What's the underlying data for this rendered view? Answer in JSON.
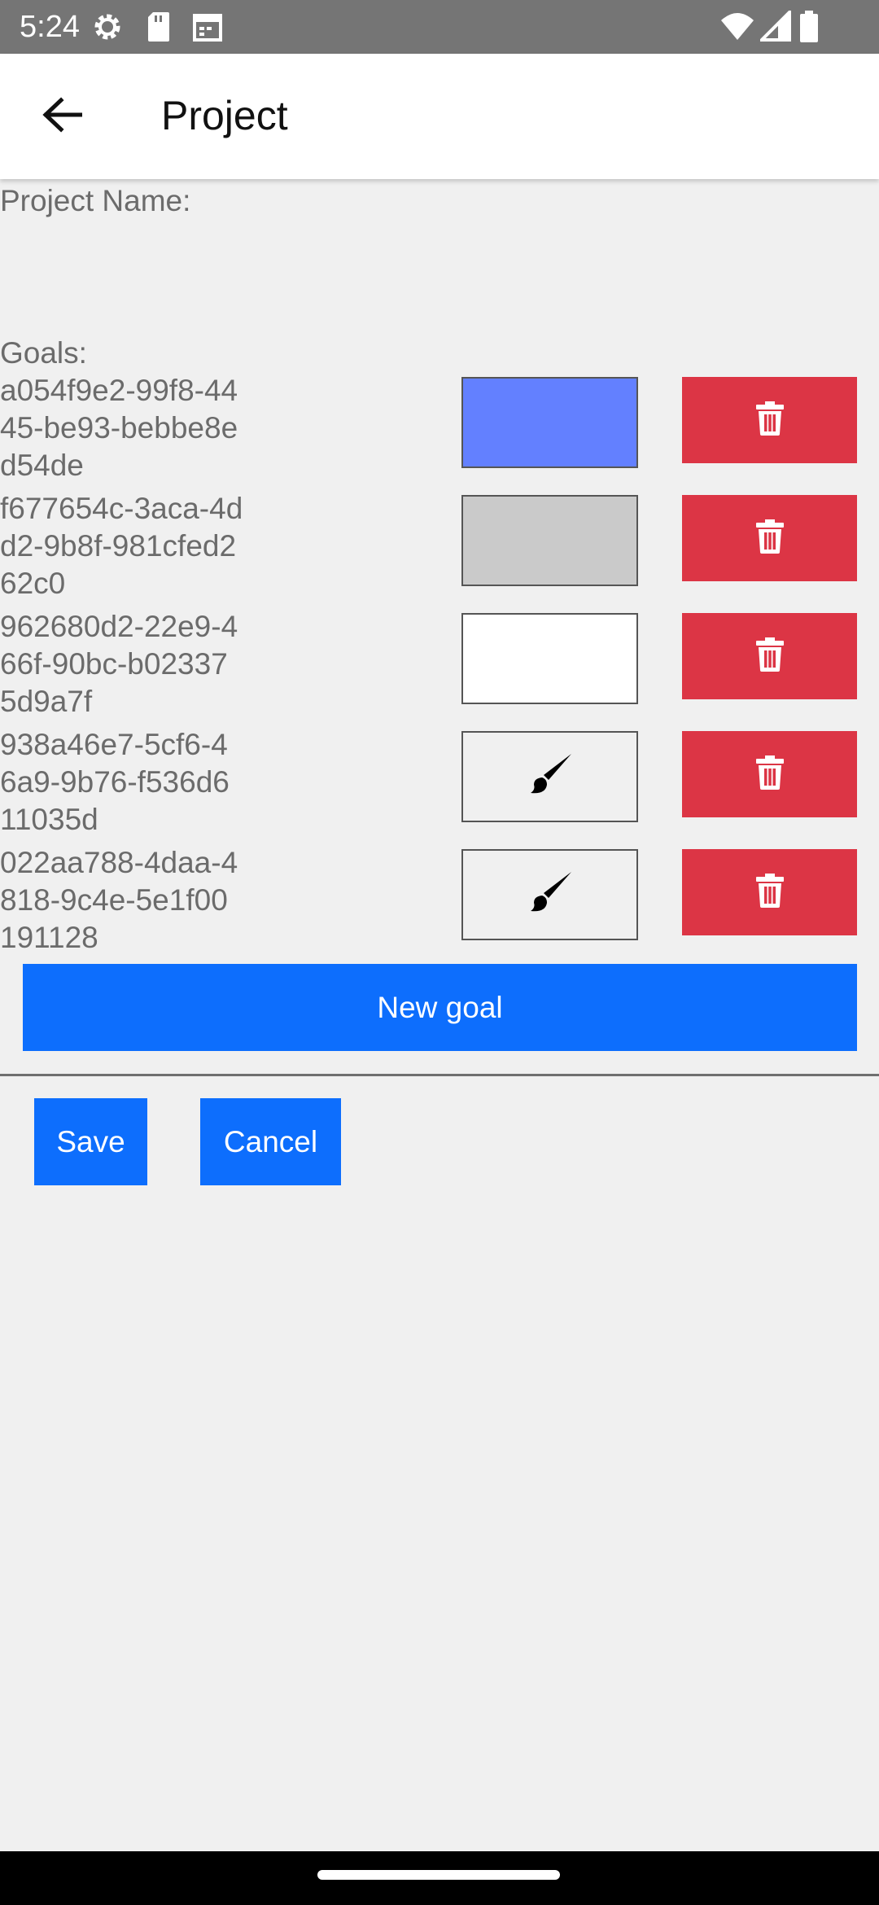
{
  "status_bar": {
    "time": "5:24",
    "left_icons": [
      "settings-icon",
      "sd-card-icon",
      "calendar-icon"
    ],
    "right_icons": [
      "wifi-icon",
      "signal-icon",
      "battery-icon"
    ]
  },
  "app_bar": {
    "back_icon": "arrow-left-icon",
    "title": "Project"
  },
  "form": {
    "project_name_label": "Project Name:",
    "project_name_value": "",
    "goals_label": "Goals:"
  },
  "goals": [
    {
      "id": "a054f9e2-99f8-4445-be93-bebbe8ed54de",
      "color": "#6380ff",
      "has_color": true
    },
    {
      "id": "f677654c-3aca-4dd2-9b8f-981cfed262c0",
      "color": "#cacaca",
      "has_color": true
    },
    {
      "id": "962680d2-22e9-466f-90bc-b023375d9a7f",
      "color": "#ffffff",
      "has_color": true
    },
    {
      "id": "938a46e7-5cf6-46a9-9b76-f536d611035d",
      "color": "#f0f0f0",
      "has_color": false,
      "icon": "paint-brush-icon"
    },
    {
      "id": "022aa788-4daa-4818-9c4e-5e1f00191128",
      "color": "#f0f0f0",
      "has_color": false,
      "icon": "paint-brush-icon"
    }
  ],
  "delete_icon": "trash-icon",
  "buttons": {
    "new_goal": "New goal",
    "save": "Save",
    "cancel": "Cancel"
  },
  "colors": {
    "primary": "#0d6efd",
    "danger": "#dc3545",
    "background": "#f0f0f0",
    "status_bar": "#757575"
  }
}
